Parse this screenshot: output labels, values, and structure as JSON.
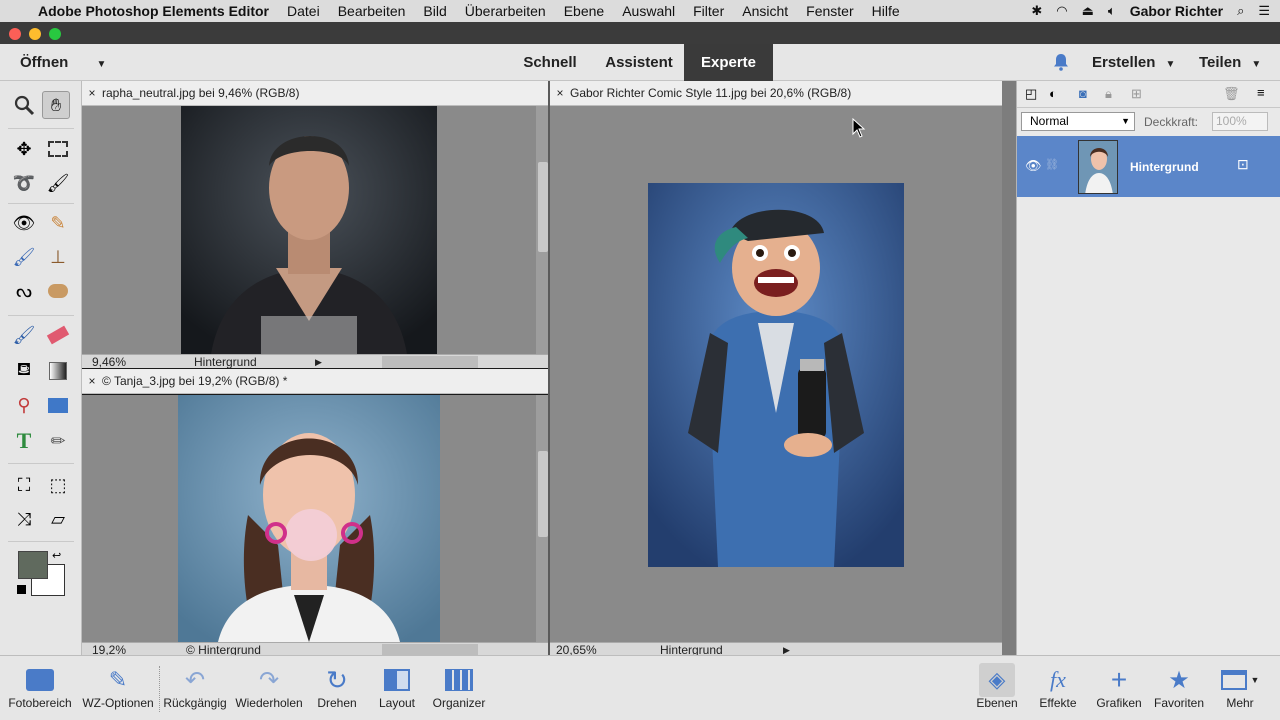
{
  "menubar": {
    "app_name": "Adobe Photoshop Elements Editor",
    "items": [
      "Datei",
      "Bearbeiten",
      "Bild",
      "Überarbeiten",
      "Ebene",
      "Auswahl",
      "Filter",
      "Ansicht",
      "Fenster",
      "Hilfe"
    ],
    "user": "Gabor Richter"
  },
  "topbar": {
    "open_label": "Öffnen",
    "modes": [
      "Schnell",
      "Assistent",
      "Experte"
    ],
    "active_mode": "Experte",
    "create_label": "Erstellen",
    "share_label": "Teilen"
  },
  "documents": {
    "doc1": {
      "tab": "rapha_neutral.jpg bei 9,46% (RGB/8)",
      "zoom": "9,46%",
      "layer": "Hintergrund"
    },
    "doc2": {
      "tab": "© Tanja_3.jpg bei 19,2% (RGB/8) *",
      "zoom": "19,2%",
      "layer": "© Hintergrund"
    },
    "doc3": {
      "tab": "Gabor Richter Comic Style 11.jpg bei 20,6% (RGB/8)",
      "zoom": "20,65%",
      "layer": "Hintergrund"
    }
  },
  "layers_panel": {
    "blend_mode": "Normal",
    "opacity_label": "Deckkraft:",
    "opacity_value": "100%",
    "layer_name": "Hintergrund"
  },
  "bottombar": {
    "left": [
      "Fotobereich",
      "WZ-Optionen",
      "Rückgängig",
      "Wiederholen",
      "Drehen",
      "Layout",
      "Organizer"
    ],
    "right": [
      "Ebenen",
      "Effekte",
      "Grafiken",
      "Favoriten",
      "Mehr"
    ]
  },
  "colors": {
    "accent": "#4a7bc8",
    "active_tab": "#3a3a3a",
    "layer_selected": "#5b86c9",
    "fg_swatch": "#606a5e"
  }
}
